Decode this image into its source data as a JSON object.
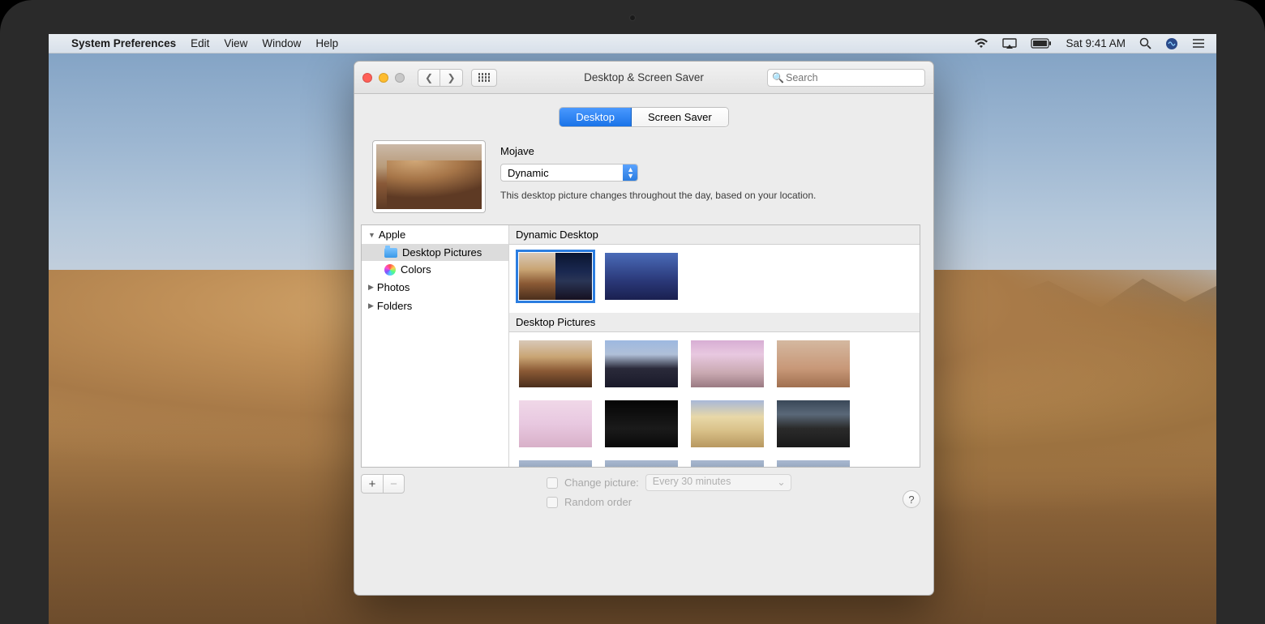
{
  "menubar": {
    "app": "System Preferences",
    "items": [
      "Edit",
      "View",
      "Window",
      "Help"
    ],
    "clock": "Sat 9:41 AM"
  },
  "window": {
    "title": "Desktop & Screen Saver",
    "search_placeholder": "Search",
    "tabs": {
      "desktop": "Desktop",
      "screensaver": "Screen Saver"
    },
    "picture_name": "Mojave",
    "type_options": [
      "Dynamic"
    ],
    "type_selected": "Dynamic",
    "description": "This desktop picture changes throughout the day, based on your location.",
    "sidebar": {
      "apple": "Apple",
      "desktop_pictures": "Desktop Pictures",
      "colors": "Colors",
      "photos": "Photos",
      "folders": "Folders"
    },
    "sections": {
      "dynamic": "Dynamic Desktop",
      "pictures": "Desktop Pictures"
    },
    "change_picture_label": "Change picture:",
    "change_interval": "Every 30 minutes",
    "random_label": "Random order"
  }
}
